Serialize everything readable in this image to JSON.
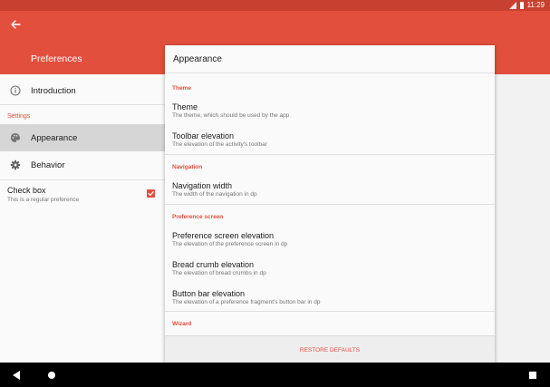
{
  "status_bar": {
    "time": "11:29",
    "network": "4G"
  },
  "app_bar": {
    "title": "Preferences",
    "back_icon": "arrow-back-icon"
  },
  "navigation": {
    "items": [
      {
        "label": "Introduction",
        "icon": "info-icon",
        "selected": false
      },
      {
        "label": "Appearance",
        "icon": "palette-icon",
        "selected": true
      },
      {
        "label": "Behavior",
        "icon": "gear-icon",
        "selected": false
      }
    ],
    "category": "Settings",
    "checkbox": {
      "title": "Check box",
      "summary": "This is a regular preference",
      "checked": true
    }
  },
  "card": {
    "title": "Appearance",
    "categories": {
      "theme": "Theme",
      "navigation": "Navigation",
      "preference_screen": "Preference screen",
      "wizard": "Wizard"
    },
    "prefs": [
      {
        "title": "Theme",
        "summary": "The theme, which should be used by the app"
      },
      {
        "title": "Toolbar elevation",
        "summary": "The elevation of the activity's toolbar"
      },
      {
        "title": "Navigation width",
        "summary": "The width of the navigation in dp"
      },
      {
        "title": "Preference screen elevation",
        "summary": "The elevation of the preference screen in dp"
      },
      {
        "title": "Bread crumb elevation",
        "summary": "The elevation of bread crumbs in dp"
      },
      {
        "title": "Button bar elevation",
        "summary": "The elevation of a preference fragment's button bar in dp"
      }
    ],
    "restore_label": "RESTORE DEFAULTS"
  },
  "colors": {
    "primary": "#e24f3d",
    "primary_dark": "#c8402f",
    "accent": "#e24f3d"
  }
}
